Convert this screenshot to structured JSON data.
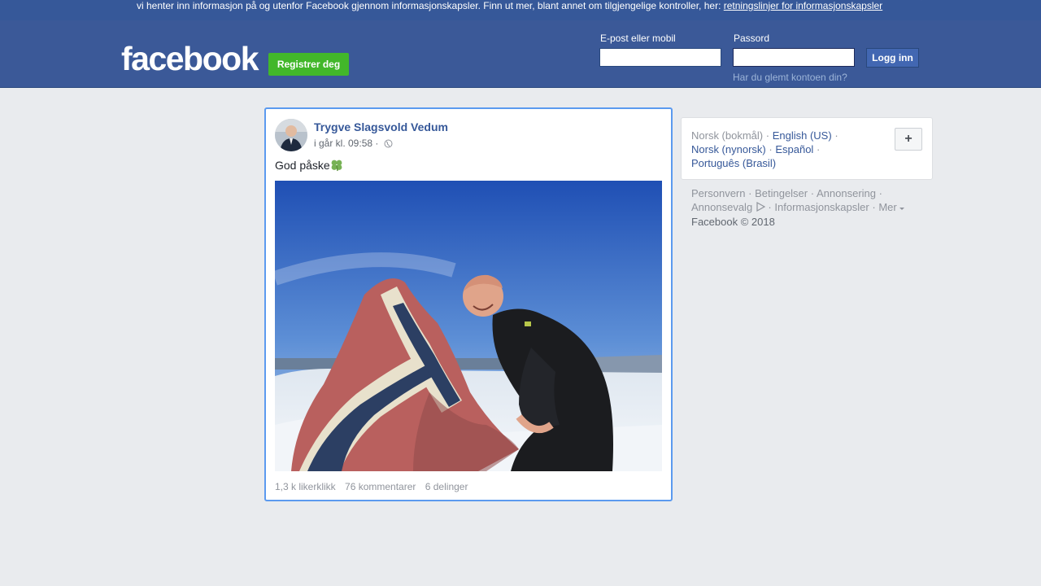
{
  "cookie_banner": {
    "text": "vi henter inn informasjon på og utenfor Facebook gjennom informasjonskapsler. Finn ut mer, blant annet om tilgjengelige kontroller, her: ",
    "link": "retningslinjer for informasjonskapsler",
    "close_icon": "close-icon"
  },
  "header": {
    "logo": "facebook",
    "register_label": "Registrer deg",
    "email_label": "E-post eller mobil",
    "email_value": "",
    "password_label": "Passord",
    "password_value": "",
    "login_label": "Logg inn",
    "forgot_label": "Har du glemt kontoen din?"
  },
  "post": {
    "author": "Trygve Slagsvold Vedum",
    "time": "i går kl. 09:58 ·",
    "audience_icon": "globe-icon",
    "text": "God påske",
    "emoji_icon": "four-leaf-clover-icon",
    "likes": "1,3 k likerklikk",
    "comments": "76 kommentarer",
    "shares": "6 delinger"
  },
  "languages": {
    "current": "Norsk (bokmål)",
    "sep": "·",
    "options": [
      "English (US)",
      "Norsk (nynorsk)",
      "Español",
      "Português (Brasil)"
    ],
    "add_icon": "plus-icon"
  },
  "footer": {
    "links": [
      "Personvern",
      "Betingelser",
      "Annonsering",
      "Annonsevalg",
      "Informasjonskapsler",
      "Mer"
    ],
    "copyright": "Facebook © 2018"
  },
  "colors": {
    "brand": "#3b5998",
    "register": "#42b72a",
    "link": "#365899",
    "background": "#e9ebee"
  }
}
